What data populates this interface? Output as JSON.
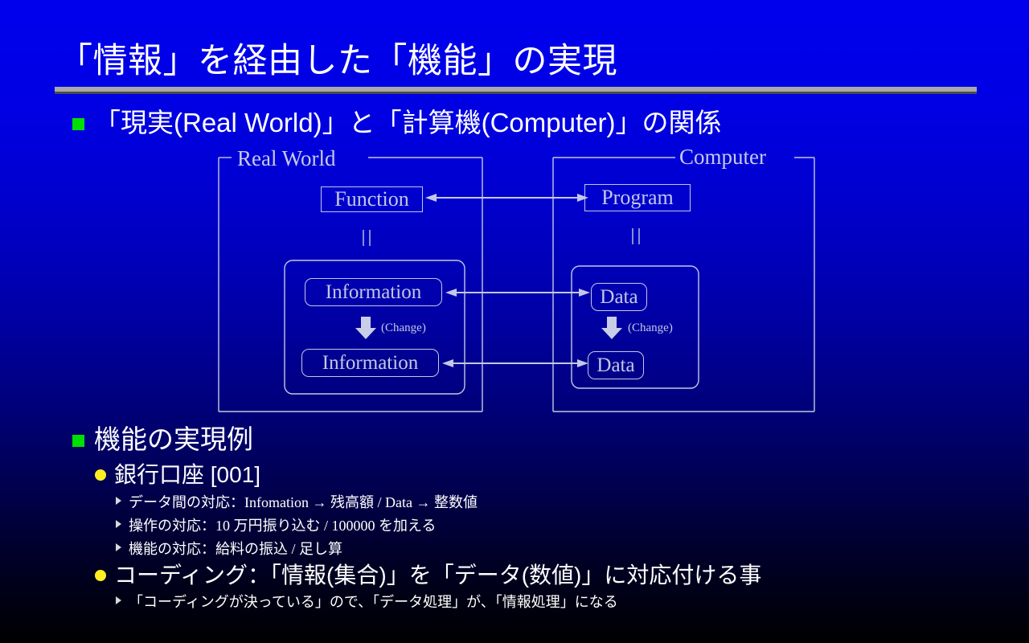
{
  "slide": {
    "title": "「情報」を経由した「機能」の実現",
    "accent_green": "#00e000",
    "accent_yellow": "#ffee22",
    "diagram_line_color": "#c3c8e6",
    "background_top": "#0000ee",
    "background_bottom": "#000000"
  },
  "bullets": {
    "b1": {
      "level": 1,
      "text": "「現実(Real World)」と「計算機(Computer)」の関係"
    },
    "b2": {
      "level": 1,
      "text": "機能の実現例"
    },
    "b3": {
      "level": 2,
      "text": "銀行口座 [001]"
    },
    "b4": {
      "level": 3,
      "text": "データ間の対応：Infomation → 残高額 / Data → 整数値"
    },
    "b5": {
      "level": 3,
      "text": "操作の対応：10 万円振り込む / 100000 を加える"
    },
    "b6": {
      "level": 3,
      "text": "機能の対応：給料の振込 / 足し算"
    },
    "b7": {
      "level": 2,
      "text": "コーディング：「情報(集合)」を「データ(数値)」に対応付ける事"
    },
    "b8": {
      "level": 3,
      "text": "「コーディングが決っている」ので、「データ処理」が、「情報処理」になる"
    }
  },
  "diagram": {
    "groups": {
      "real_world": {
        "label": "Real World",
        "label_align": "left"
      },
      "computer": {
        "label": "Computer",
        "label_align": "right"
      }
    },
    "nodes": {
      "function": "Function",
      "program": "Program",
      "information_top": "Information",
      "information_bottom": "Information",
      "data_top": "Data",
      "data_bottom": "Data"
    },
    "equivalence_symbol": "||",
    "change_left": "(Change)",
    "change_right": "(Change)"
  }
}
